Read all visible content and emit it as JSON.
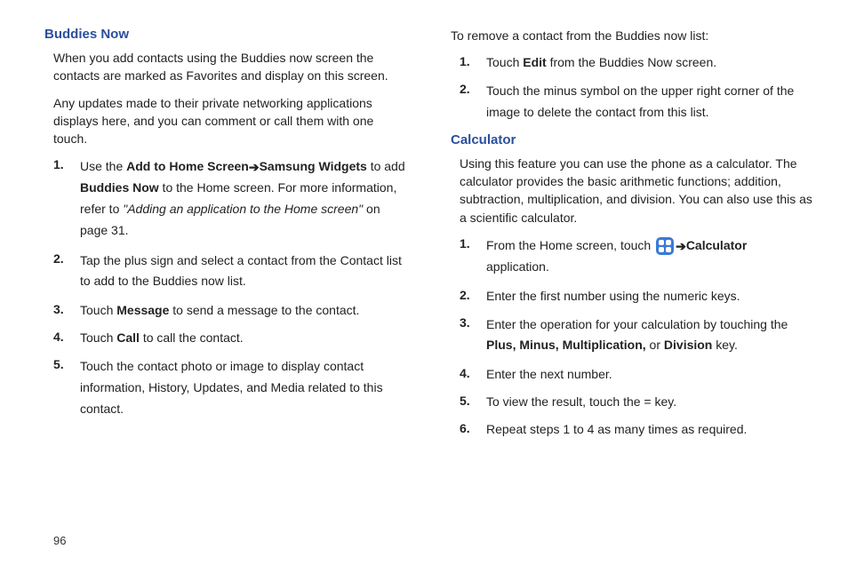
{
  "page_number": "96",
  "left": {
    "heading": "Buddies Now",
    "p1": "When you add contacts using the Buddies now screen the contacts are marked as Favorites and display on this screen.",
    "p2": "Any updates made to their private networking applications displays here, and you can comment or call them with one touch.",
    "items": [
      {
        "num": "1.",
        "pre": "Use the ",
        "b1": "Add to Home Screen",
        "arrow": " ➔ ",
        "b2": "Samsung Widgets",
        "mid": " to add ",
        "b3": "Buddies Now",
        "post1": " to the Home screen. For more information, refer to ",
        "ref": "\"Adding an application to the Home screen\"",
        "post2": "  on page 31."
      },
      {
        "num": "2.",
        "text": "Tap the plus sign and select a contact from the Contact list to add to the Buddies now list."
      },
      {
        "num": "3.",
        "pre": "Touch ",
        "b1": "Message",
        "post": " to send a message to the contact."
      },
      {
        "num": "4.",
        "pre": "Touch ",
        "b1": "Call",
        "post": " to call the contact."
      },
      {
        "num": "5.",
        "text": "Touch the contact photo or image to display contact information, History, Updates, and Media related to this contact."
      }
    ]
  },
  "right": {
    "intro": "To remove a contact from the Buddies now list:",
    "remove": [
      {
        "num": "1.",
        "pre": "Touch ",
        "b1": "Edit",
        "post": " from the Buddies Now screen."
      },
      {
        "num": "2.",
        "text": "Touch the minus symbol on the upper right corner of the image to delete the contact from this list."
      }
    ],
    "heading": "Calculator",
    "p1": "Using this feature you can use the phone as a calculator. The calculator provides the basic arithmetic functions; addition, subtraction, multiplication, and division. You can also use this as a scientific calculator.",
    "items": [
      {
        "num": "1.",
        "pre": "From the Home screen, touch ",
        "arrow": " ➔ ",
        "b1": "Calculator",
        "post": " application."
      },
      {
        "num": "2.",
        "text": "Enter the first number using the numeric keys."
      },
      {
        "num": "3.",
        "pre": "Enter the operation for your calculation by touching the ",
        "b1": "Plus, Minus, Multiplication,",
        "mid": " or ",
        "b2": "Division",
        "post": " key."
      },
      {
        "num": "4.",
        "text": "Enter the next number."
      },
      {
        "num": "5.",
        "text": "To view the result, touch the =  key."
      },
      {
        "num": "6.",
        "text": "Repeat steps 1 to 4 as many times as required."
      }
    ]
  }
}
